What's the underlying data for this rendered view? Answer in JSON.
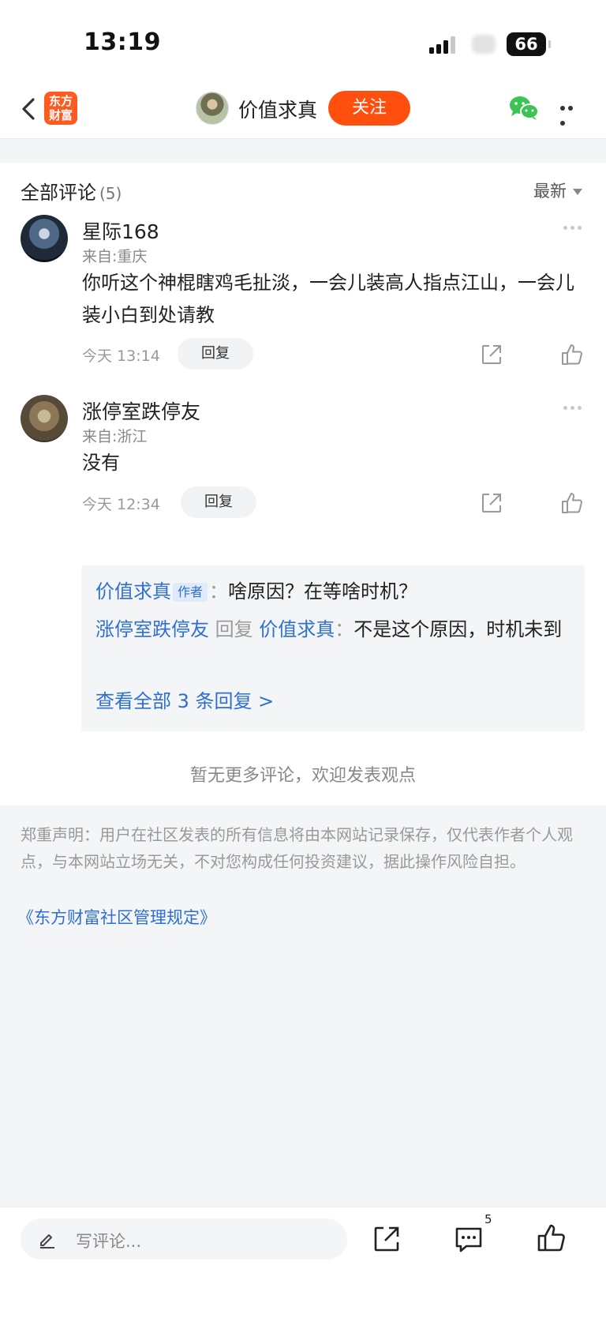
{
  "status_bar": {
    "time": "13:19",
    "battery": "66"
  },
  "nav": {
    "logo_line1": "东方",
    "logo_line2": "财富",
    "author_name": "价值求真",
    "follow_label": "关注"
  },
  "comments_section": {
    "title": "全部评论",
    "count": "(5)",
    "sort_label": "最新"
  },
  "comments": [
    {
      "username": "星际168",
      "location": "来自:重庆",
      "text": "你听这个神棍瞎鸡毛扯淡，一会儿装高人指点江山，一会儿装小白到处请教",
      "time": "今天 13:14",
      "reply_label": "回复"
    },
    {
      "username": "涨停室跌停友",
      "location": "来自:浙江",
      "text": "没有",
      "time": "今天 12:34",
      "reply_label": "回复"
    }
  ],
  "replies": {
    "reply1_user": "价值求真",
    "reply1_tag": "作者",
    "reply1_sep": "：",
    "reply1_text": "啥原因？在等啥时机？",
    "reply2_user": "涨停室跌停友",
    "reply2_verb": " 回复 ",
    "reply2_target": "价值求真",
    "reply2_sep": "：",
    "reply2_text": "不是这个原因，时机未到",
    "view_all": "查看全部 3 条回复 >"
  },
  "no_more_text": "暂无更多评论，欢迎发表观点",
  "disclaimer": "郑重声明：用户在社区发表的所有信息将由本网站记录保存，仅代表作者个人观点，与本网站立场无关，不对您构成任何投资建议，据此操作风险自担。",
  "rules_link": "《东方财富社区管理规定》",
  "bottom_bar": {
    "input_placeholder": "写评论...",
    "comment_badge": "5"
  },
  "colors": {
    "accent": "#ff4f0f",
    "link": "#2e6fd1",
    "wechat": "#3dc256"
  }
}
